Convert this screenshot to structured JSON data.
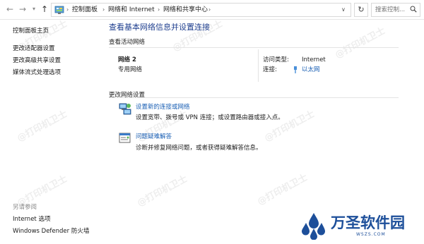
{
  "address_bar": {
    "breadcrumbs": [
      "控制面板",
      "网络和 Internet",
      "网络和共享中心"
    ],
    "search_placeholder": "搜索控制..."
  },
  "sidebar": {
    "top_links": [
      "控制面板主页",
      "更改适配器设置",
      "更改高级共享设置",
      "媒体流式处理选项"
    ],
    "see_also_heading": "另请参阅",
    "see_also_links": [
      "Internet 选项",
      "Windows Defender 防火墙"
    ]
  },
  "main": {
    "title": "查看基本网络信息并设置连接",
    "active_networks_label": "查看活动网络",
    "network": {
      "name": "网络 2",
      "type": "专用网络",
      "access_type_label": "访问类型:",
      "access_type_value": "Internet",
      "connections_label": "连接:",
      "connections_value": "以太网"
    },
    "change_settings_label": "更改网络设置",
    "actions": [
      {
        "link": "设置新的连接或网络",
        "desc": "设置宽带、拨号或 VPN 连接；或设置路由器或接入点。",
        "icon": "network-setup-icon"
      },
      {
        "link": "问题疑难解答",
        "desc": "诊断并修复网络问题，或者获得疑难解答信息。",
        "icon": "troubleshoot-icon"
      }
    ]
  },
  "watermark_text": "@打印机卫士",
  "logo": {
    "name": "万圣软件园",
    "url": "WSZS.COM"
  },
  "colors": {
    "title": "#1f3f8f",
    "link": "#1a5fb4",
    "logo": "#1d4f9a"
  }
}
